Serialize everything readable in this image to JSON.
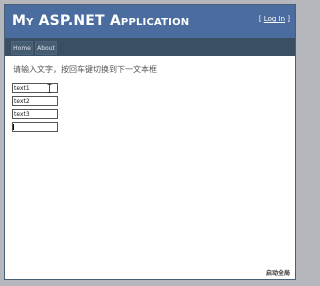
{
  "header": {
    "title": "My ASP.NET Application",
    "login_prefix": "[ ",
    "login_link": "Log In",
    "login_suffix": " ]"
  },
  "menu": {
    "items": [
      {
        "label": "Home"
      },
      {
        "label": "About"
      }
    ]
  },
  "main": {
    "instruction": "请输入文字，按回车键切换到下一文本框",
    "textboxes": [
      {
        "value": "text1"
      },
      {
        "value": "text2"
      },
      {
        "value": "text3"
      },
      {
        "value": ""
      }
    ]
  },
  "footer": {
    "text": "启动全局"
  },
  "colors": {
    "header_bg": "#4b6c9e",
    "menu_bg": "#3a4f63",
    "page_bg": "#b6b7bc"
  }
}
